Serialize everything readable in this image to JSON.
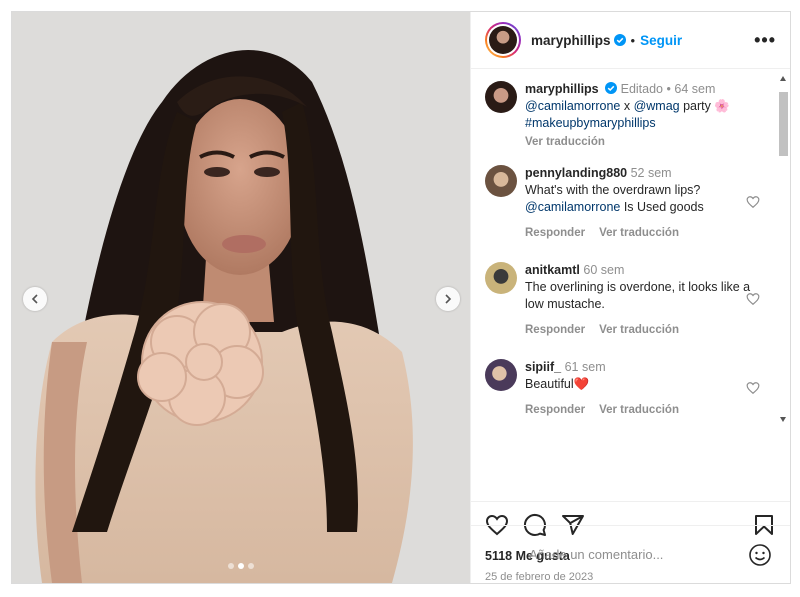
{
  "header": {
    "username": "maryphillips",
    "separator": "•",
    "follow_label": "Seguir",
    "more_label": "•••"
  },
  "caption": {
    "username": "maryphillips",
    "edited": "Editado",
    "dot": "•",
    "time": "64 sem",
    "mention1": "@camilamorrone",
    "text_x": " x ",
    "mention2": "@wmag",
    "text_party": " party ",
    "emoji": "🌸",
    "hashtag": "#makeupbymaryphillips",
    "translate": "Ver traducción"
  },
  "comments": [
    {
      "username": "pennylanding880",
      "time": "52 sem",
      "text1": "What's with the overdrawn lips?",
      "mention": "@camilamorrone",
      "text2": " Is Used goods",
      "reply": "Responder",
      "translate": "Ver traducción"
    },
    {
      "username": "anitkamtl",
      "time": "60 sem",
      "text1": "The overlining is overdone, it looks like a low mustache.",
      "reply": "Responder",
      "translate": "Ver traducción"
    },
    {
      "username": "sipiif_",
      "time": "61 sem",
      "text1": "Beautiful",
      "emoji": "❤️",
      "reply": "Responder",
      "translate": "Ver traducción"
    }
  ],
  "likes": "5118 Me gusta",
  "date": "25 de febrero de 2023",
  "comment_input": {
    "placeholder": "Añade un comentario..."
  },
  "carousel": {
    "count": 3,
    "active": 2
  },
  "colors": {
    "link": "#00376b",
    "follow": "#0095f6",
    "muted": "#8e8e8e",
    "verified": "#0095f6"
  },
  "icons": [
    "chevron-left-icon",
    "chevron-right-icon",
    "heart-icon",
    "comment-icon",
    "share-icon",
    "bookmark-icon",
    "emoji-icon",
    "more-icon",
    "verified-icon"
  ]
}
